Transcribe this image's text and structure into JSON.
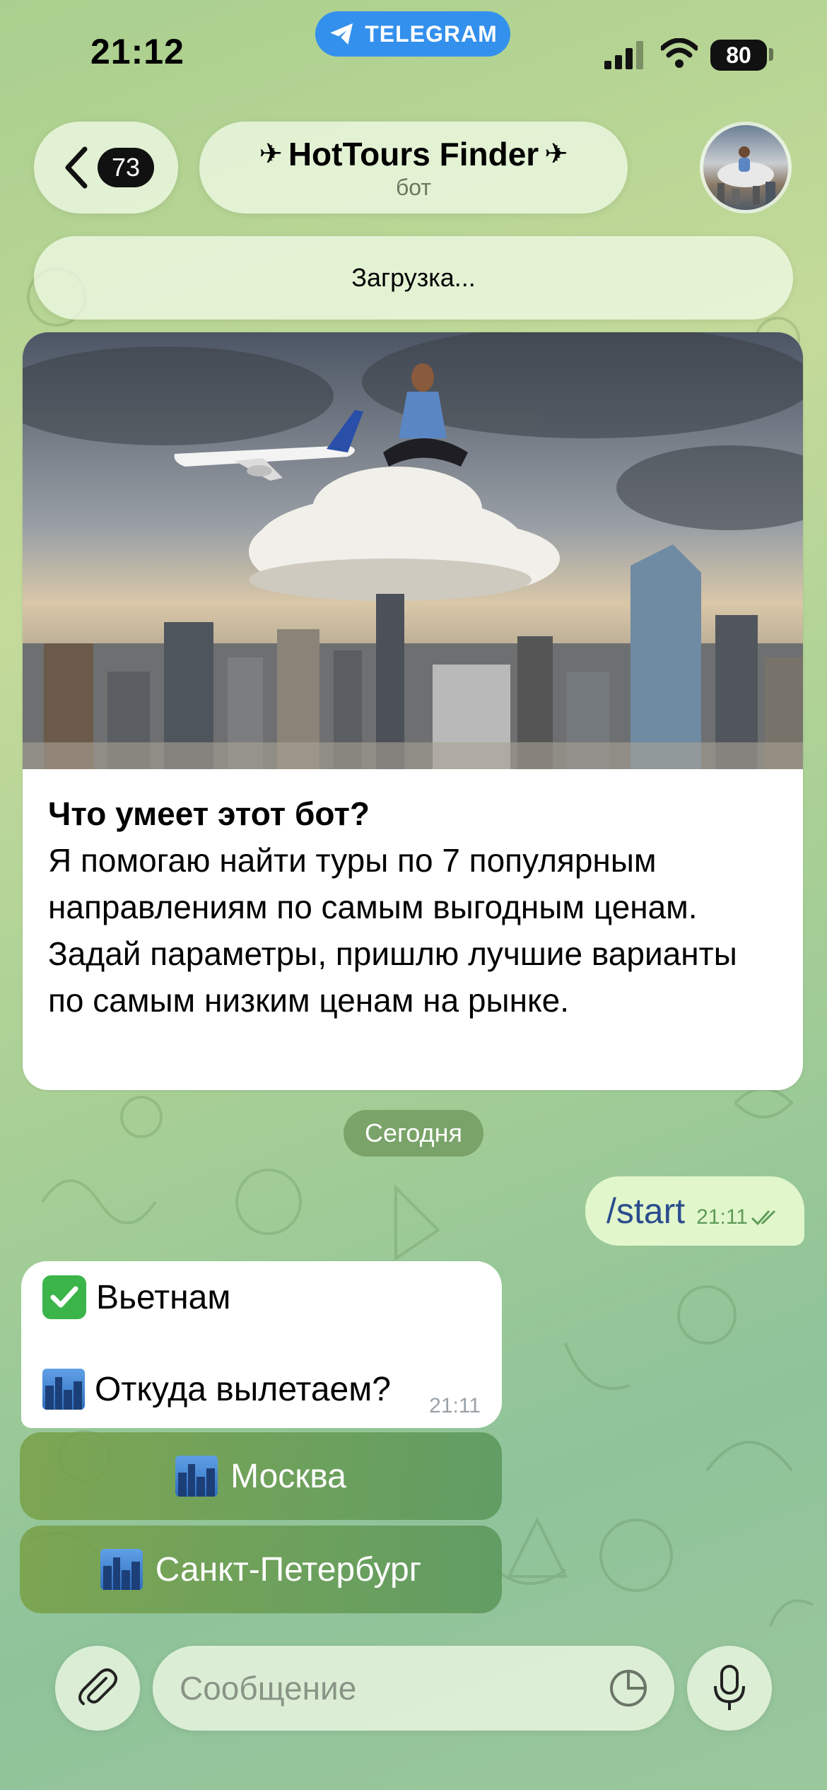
{
  "status_bar": {
    "time": "21:12",
    "app_pill": "TELEGRAM",
    "battery": "80"
  },
  "header": {
    "back_count": "73",
    "title": "HotTours Finder",
    "subtitle": "бот"
  },
  "loading": "Загрузка...",
  "intro": {
    "title": "Что умеет этот бот?",
    "body": "Я помогаю найти туры по 7 популярным направлениям по самым выгодным ценам. Задай параметры, пришлю лучшие варианты по самым низким ценам на рынке."
  },
  "date_chip": "Сегодня",
  "outgoing": {
    "text": "/start",
    "time": "21:11"
  },
  "incoming": {
    "line1": "Вьетнам",
    "line2": "Откуда вылетаем?",
    "time": "21:11"
  },
  "keyboard": [
    {
      "label": "Москва"
    },
    {
      "label": "Санкт-Петербург"
    }
  ],
  "composer": {
    "placeholder": "Сообщение"
  },
  "colors": {
    "accent": "#3390ec",
    "outgoing_bubble": "#e1f7cb",
    "keyboard_button": "#7aa256"
  }
}
